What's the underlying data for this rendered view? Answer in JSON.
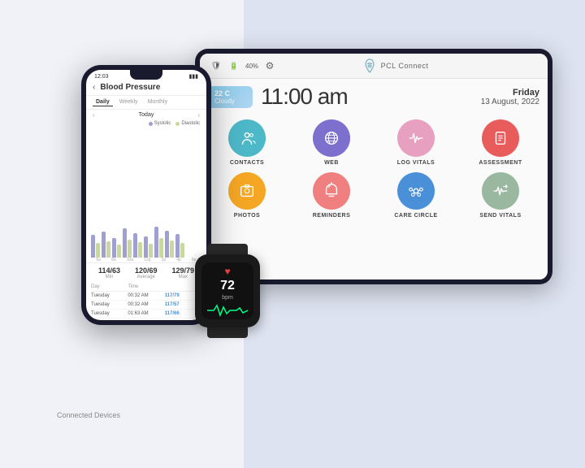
{
  "background": {
    "left_color": "#f0f2f8",
    "right_color": "#dde3f0"
  },
  "tablet": {
    "topbar": {
      "shield_icon": "🛡",
      "battery_icon": "🔋",
      "battery_percent": "40%",
      "settings_icon": "⚙",
      "logo_text": "PCL Connect"
    },
    "weather": {
      "temp": "22 C",
      "description": "Cloudy"
    },
    "time": "11:00 am",
    "date": {
      "day": "Friday",
      "full": "13 August, 2022"
    },
    "apps": [
      {
        "id": "contacts",
        "label": "CONTACTS",
        "color": "#4db8c8"
      },
      {
        "id": "web",
        "label": "WEB",
        "color": "#7c6fcd"
      },
      {
        "id": "log-vitals",
        "label": "LOG VITALS",
        "color": "#e8a0c0"
      },
      {
        "id": "assessment",
        "label": "ASSESSMENT",
        "color": "#e85c5c"
      },
      {
        "id": "photos",
        "label": "PHOTOS",
        "color": "#f5a623"
      },
      {
        "id": "reminders",
        "label": "REMINDERS",
        "color": "#f08080"
      },
      {
        "id": "care-circle",
        "label": "CARE CIRCLE",
        "color": "#4a90d9"
      },
      {
        "id": "send-vitals",
        "label": "SEND VITALS",
        "color": "#9ab8a0"
      }
    ]
  },
  "phone": {
    "status_time": "12:03",
    "title": "Blood Pressure",
    "tabs": [
      "Daily",
      "Weekly",
      "Monthly"
    ],
    "active_tab": "Daily",
    "nav_label": "Today",
    "legend": [
      {
        "label": "Systolic",
        "color": "#a0a0d0"
      },
      {
        "label": "Diastolic",
        "color": "#c8d8a0"
      }
    ],
    "stats": [
      {
        "value": "114/63",
        "label": "Min"
      },
      {
        "value": "120/69",
        "label": "Average"
      },
      {
        "value": "129/79",
        "label": "Max"
      }
    ],
    "table_headers": [
      "Day",
      "Time",
      ""
    ],
    "table_rows": [
      {
        "day": "Tuesday",
        "time": "00:32 AM",
        "value": "117/79"
      },
      {
        "day": "Tuesday",
        "time": "00:32 AM",
        "value": "117/57"
      },
      {
        "day": "Tuesday",
        "time": "01:63 AM",
        "value": "117/66"
      }
    ]
  },
  "watch": {
    "hr_value": "72",
    "hr_unit": "bpm"
  },
  "phone_label": "Connected Devices"
}
